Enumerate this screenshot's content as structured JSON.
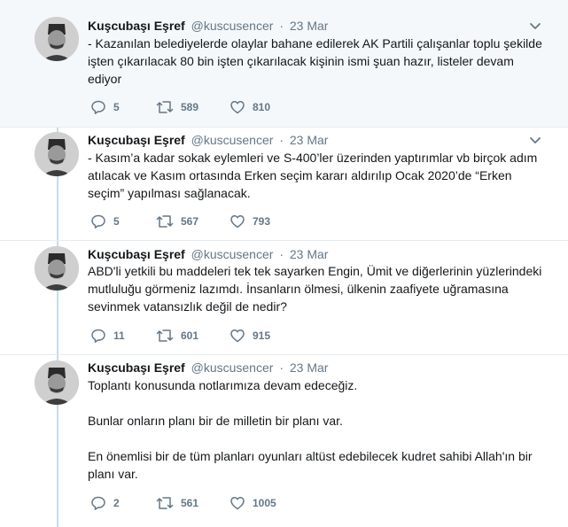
{
  "tweets": [
    {
      "name": "Kuşcubaşı Eşref",
      "handle": "@kuscusencer",
      "dot": "·",
      "time": "23 Mar",
      "text": "- Kazanılan belediyelerde olaylar bahane edilerek AK Partili çalışanlar toplu şekilde işten çıkarılacak 80 bin işten çıkarılacak kişinin ismi şuan hazır, listeler devam ediyor",
      "replies": "5",
      "retweets": "589",
      "likes": "810"
    },
    {
      "name": "Kuşcubaşı Eşref",
      "handle": "@kuscusencer",
      "dot": "·",
      "time": "23 Mar",
      "text": "- Kasım’a kadar sokak eylemleri ve S-400’ler üzerinden yaptırımlar vb birçok adım atılacak ve Kasım ortasında Erken seçim kararı aldırılıp Ocak 2020’de “Erken seçim” yapılması sağlanacak.",
      "replies": "5",
      "retweets": "567",
      "likes": "793"
    },
    {
      "name": "Kuşcubaşı Eşref",
      "handle": "@kuscusencer",
      "dot": "·",
      "time": "23 Mar",
      "text": "ABD'li yetkili bu maddeleri tek tek sayarken Engin, Ümit ve diğerlerinin yüzlerindeki mutluluğu görmeniz lazımdı. İnsanların ölmesi, ülkenin zaafiyete uğramasına sevinmek vatansızlık değil de nedir?",
      "replies": "11",
      "retweets": "601",
      "likes": "915"
    },
    {
      "name": "Kuşcubaşı Eşref",
      "handle": "@kuscusencer",
      "dot": "·",
      "time": "23 Mar",
      "text": "Toplantı konusunda notlarımıza devam edeceğiz.\n\nBunlar onların planı bir de milletin bir planı var.\n\nEn önemlisi bir de tüm planları oyunları altüst edebilecek kudret sahibi Allah'ın bir planı var.",
      "replies": "2",
      "retweets": "561",
      "likes": "1005"
    }
  ],
  "colors": {
    "text": "#14171a",
    "secondary": "#657786",
    "thread_line": "#c4dbe9",
    "highlight_bg": "#f5f8fa",
    "divider": "#e6ecf0"
  },
  "icons": {
    "reply": "reply-icon",
    "retweet": "retweet-icon",
    "like": "heart-icon",
    "menu": "chevron-down-icon"
  }
}
